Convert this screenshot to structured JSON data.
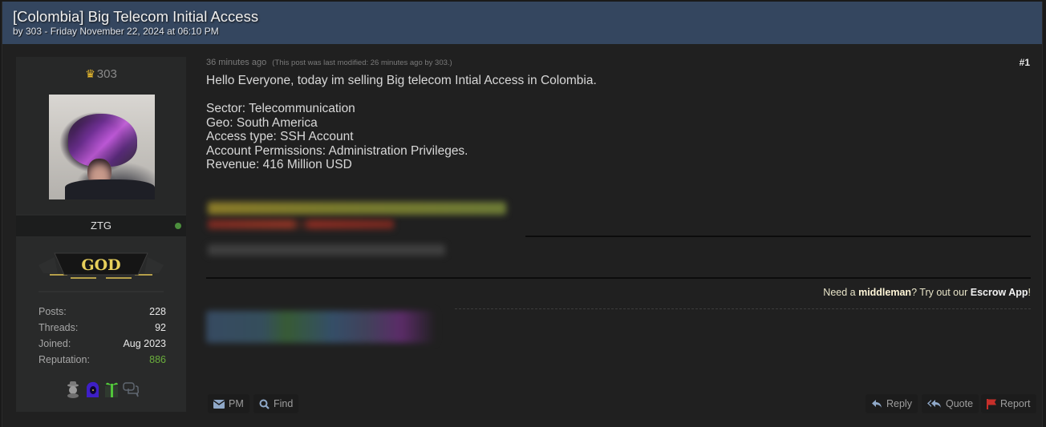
{
  "thread": {
    "title": "[Colombia] Big Telecom Initial Access",
    "byline": "by 303 - Friday November 22, 2024 at 06:10 PM"
  },
  "user": {
    "handle": "303",
    "display_name": "ZTG",
    "online": true,
    "rank": "GOD",
    "stats": [
      {
        "label": "Posts:",
        "value": "228"
      },
      {
        "label": "Threads:",
        "value": "92"
      },
      {
        "label": "Joined:",
        "value": "Aug 2023"
      },
      {
        "label": "Reputation:",
        "value": "886"
      }
    ],
    "awards": [
      "spy-award-icon",
      "hood-award-icon",
      "gift-award-icon",
      "chat-award-icon"
    ]
  },
  "post": {
    "time": "36 minutes ago",
    "modified": "(This post was last modified: 26 minutes ago by 303.)",
    "number": "#1",
    "intro": "Hello Everyone, today im selling Big telecom Intial Access in Colombia.",
    "details": [
      "Sector: Telecommunication",
      "Geo: South America",
      "Access type: SSH Account",
      "Account Permissions: Administration Privileges.",
      "Revenue: 416 Million USD"
    ]
  },
  "signature": {
    "pre": "Need a ",
    "middleman": "middleman",
    "mid": "? Try out our ",
    "app": "Escrow App",
    "post": "!"
  },
  "actions": {
    "pm": "PM",
    "find": "Find",
    "reply": "Reply",
    "quote": "Quote",
    "report": "Report"
  },
  "colors": {
    "header_bg": "#34465f",
    "reputation": "#6aae3c",
    "crown": "#f2c12e",
    "report_flag": "#c62f2a"
  }
}
